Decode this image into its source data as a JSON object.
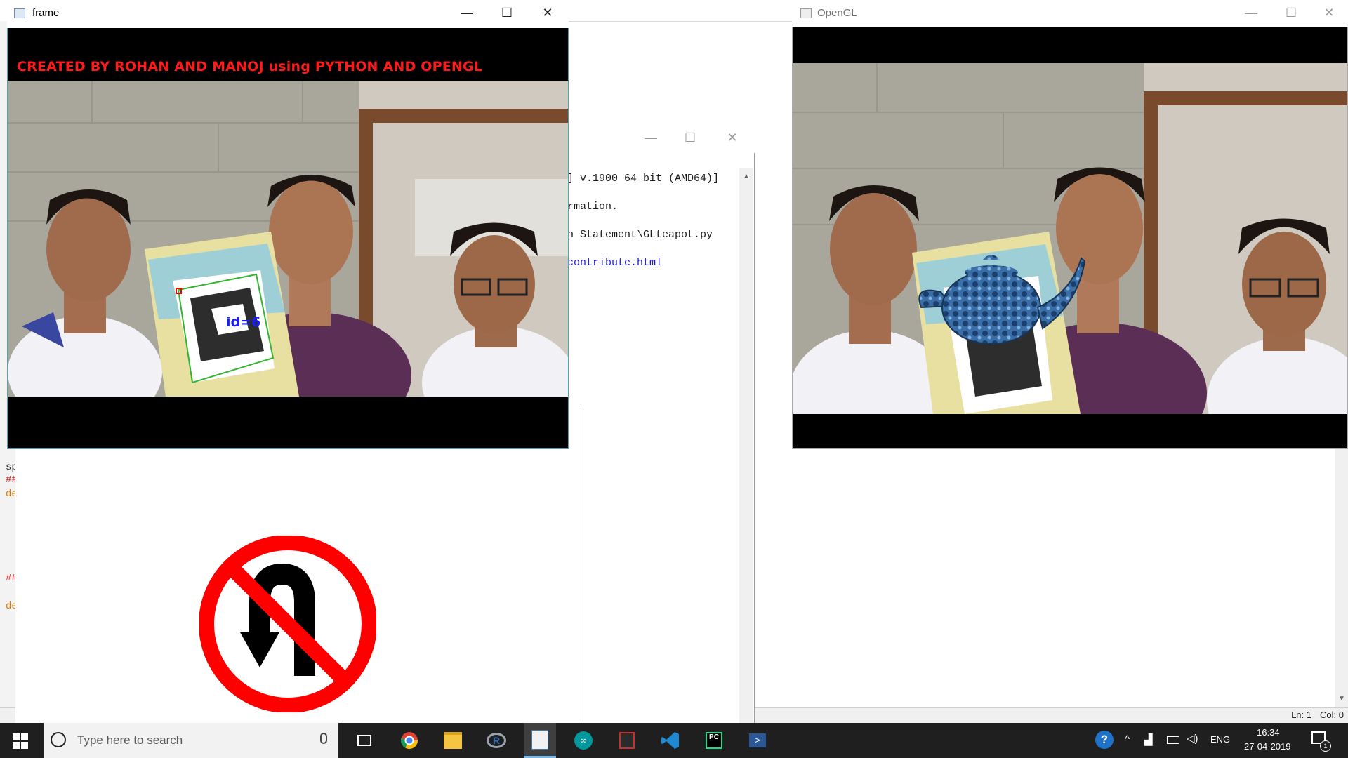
{
  "background_editor": {
    "status_ln": "Ln: 1",
    "status_col": "Col: 0",
    "partial_code": [
      "sp",
      "##",
      "de",
      "##",
      "de"
    ]
  },
  "shell_window": {
    "lines": [
      "] v.1900 64 bit (AMD64)]",
      "rmation.",
      "n Statement\\GLteapot.py",
      "contribute.html"
    ]
  },
  "frame_window": {
    "title": "frame",
    "caption": "CREATED BY ROHAN AND MANOJ using PYTHON AND OPENGL",
    "marker_label": "id=6"
  },
  "opengl_window": {
    "title": "OpenGL"
  },
  "window_controls": {
    "minimize": "—",
    "maximize": "☐",
    "close": "✕"
  },
  "taskbar": {
    "search_placeholder": "Type here to search",
    "language": "ENG",
    "time": "16:34",
    "date": "27-04-2019",
    "notification_count": "1",
    "partial_label": "Ln: 1  Col: 0"
  },
  "colors": {
    "caption_red": "#ff1a1a",
    "marker_blue": "#1a1aff",
    "taskbar": "#1f1f1f"
  }
}
